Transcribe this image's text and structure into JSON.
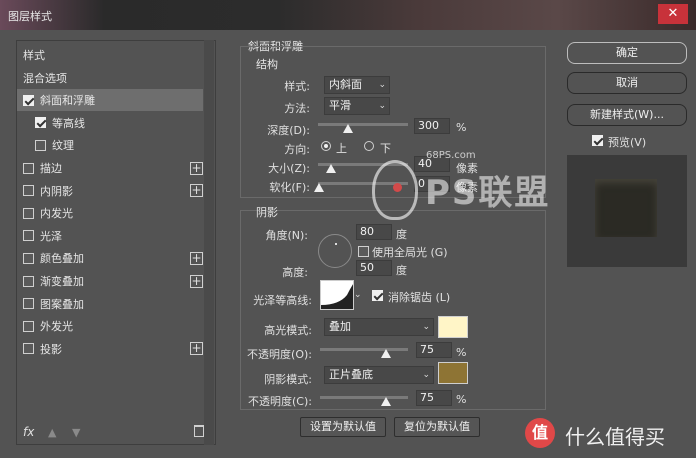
{
  "window": {
    "title": "图层样式",
    "close_label": "✕"
  },
  "sidebar": {
    "items": [
      {
        "label": "样式",
        "checkbox": false,
        "checked": false,
        "plus": false,
        "indent": 0,
        "selected": false
      },
      {
        "label": "混合选项",
        "checkbox": false,
        "checked": false,
        "plus": false,
        "indent": 0,
        "selected": false
      },
      {
        "label": "斜面和浮雕",
        "checkbox": true,
        "checked": true,
        "plus": false,
        "indent": 0,
        "selected": true
      },
      {
        "label": "等高线",
        "checkbox": true,
        "checked": true,
        "plus": false,
        "indent": 1,
        "selected": false
      },
      {
        "label": "纹理",
        "checkbox": true,
        "checked": false,
        "plus": false,
        "indent": 1,
        "selected": false
      },
      {
        "label": "描边",
        "checkbox": true,
        "checked": false,
        "plus": true,
        "indent": 0,
        "selected": false
      },
      {
        "label": "内阴影",
        "checkbox": true,
        "checked": false,
        "plus": true,
        "indent": 0,
        "selected": false
      },
      {
        "label": "内发光",
        "checkbox": true,
        "checked": false,
        "plus": false,
        "indent": 0,
        "selected": false
      },
      {
        "label": "光泽",
        "checkbox": true,
        "checked": false,
        "plus": false,
        "indent": 0,
        "selected": false
      },
      {
        "label": "颜色叠加",
        "checkbox": true,
        "checked": false,
        "plus": true,
        "indent": 0,
        "selected": false
      },
      {
        "label": "渐变叠加",
        "checkbox": true,
        "checked": false,
        "plus": true,
        "indent": 0,
        "selected": false
      },
      {
        "label": "图案叠加",
        "checkbox": true,
        "checked": false,
        "plus": false,
        "indent": 0,
        "selected": false
      },
      {
        "label": "外发光",
        "checkbox": true,
        "checked": false,
        "plus": false,
        "indent": 0,
        "selected": false
      },
      {
        "label": "投影",
        "checkbox": true,
        "checked": false,
        "plus": true,
        "indent": 0,
        "selected": false
      }
    ],
    "fx_label": "fx"
  },
  "bevel": {
    "section_title": "斜面和浮雕",
    "structure_title": "结构",
    "style_label": "样式:",
    "style_value": "内斜面",
    "technique_label": "方法:",
    "technique_value": "平滑",
    "depth_label": "深度(D):",
    "depth_value": "300",
    "depth_unit": "%",
    "depth_level": 0.3,
    "direction_label": "方向:",
    "direction_up": "上",
    "direction_down": "下",
    "size_label": "大小(Z):",
    "size_value": "40",
    "size_unit": "像素",
    "soften_label": "软化(F):",
    "soften_value": "0",
    "soften_unit": "像素"
  },
  "shading": {
    "title": "阴影",
    "angle_label": "角度(N):",
    "angle_value": "80",
    "angle_unit": "度",
    "global_light_label": "使用全局光 (G)",
    "altitude_label": "高度:",
    "altitude_value": "50",
    "altitude_unit": "度",
    "gloss_contour_label": "光泽等高线:",
    "anti_alias_label": "消除锯齿 (L)",
    "highlight_mode_label": "高光模式:",
    "highlight_mode_value": "叠加",
    "highlight_color": "#fff5c7",
    "highlight_opacity_label": "不透明度(O):",
    "highlight_opacity_value": "75",
    "opacity_unit": "%",
    "shadow_mode_label": "阴影模式:",
    "shadow_mode_value": "正片叠底",
    "shadow_color": "#8e7434",
    "shadow_opacity_label": "不透明度(C):",
    "shadow_opacity_value": "75"
  },
  "footer": {
    "set_default": "设置为默认值",
    "reset_default": "复位为默认值"
  },
  "actions": {
    "ok": "确定",
    "cancel": "取消",
    "new_style": "新建样式(W)...",
    "preview_label": "预览(V)"
  },
  "watermark": {
    "site": "68PS.com",
    "brand": "PS联盟"
  },
  "bottom_brand": {
    "icon": "值",
    "text": "什么值得买"
  }
}
